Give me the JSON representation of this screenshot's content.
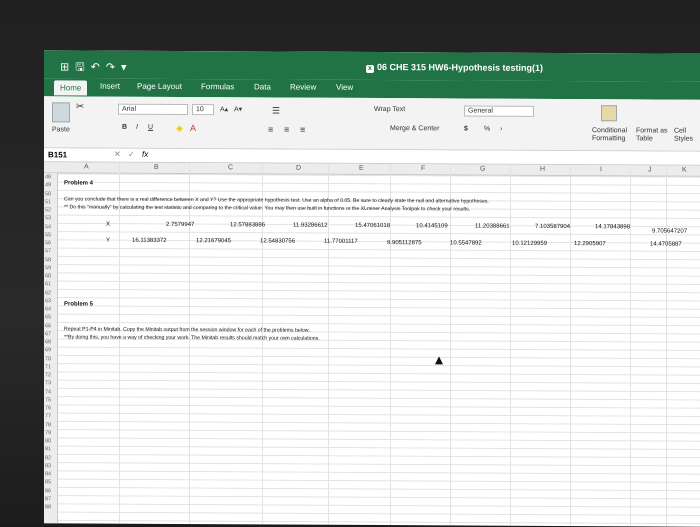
{
  "window": {
    "title": "06 CHE 315 HW6-Hypothesis testing(1)",
    "quick_access": [
      "⊞",
      "🖫",
      "↶",
      "↷",
      "▾"
    ]
  },
  "tabs": [
    "Home",
    "Insert",
    "Page Layout",
    "Formulas",
    "Data",
    "Review",
    "View"
  ],
  "ribbon": {
    "paste_label": "Paste",
    "font_name": "Arial",
    "font_size": "10",
    "font_grow": "A▴",
    "font_shrink": "A▾",
    "bold": "B",
    "italic": "I",
    "underline": "U",
    "wrap_text": "Wrap Text",
    "merge_center": "Merge & Center",
    "number_format": "General",
    "currency": "$",
    "percent": "%",
    "comma": "›",
    "conditional_formatting": "Conditional Formatting",
    "format_as_table": "Format as Table",
    "cell_styles": "Cell Styles"
  },
  "formula_bar": {
    "name_box": "B151",
    "fx": "fx",
    "formula": ""
  },
  "columns": [
    "A",
    "B",
    "C",
    "D",
    "E",
    "F",
    "G",
    "H",
    "I",
    "J",
    "K"
  ],
  "row_numbers": [
    "48",
    "49",
    "50",
    "51",
    "52",
    "53",
    "54",
    "55",
    "56",
    "57",
    "58",
    "59",
    "60",
    "61",
    "62",
    "63",
    "64",
    "65",
    "66",
    "67",
    "68",
    "69",
    "70",
    "71",
    "72",
    "73",
    "74",
    "75",
    "76",
    "77",
    "78",
    "79",
    "80",
    "81",
    "82",
    "83",
    "84",
    "85",
    "86",
    "87",
    "88"
  ],
  "sheet": {
    "problem4_title": "Problem 4",
    "problem4_line1": "Can you conclude that there is a real difference between X and Y? Use the appropriate hypothesis test. Use an alpha of 0.05. Be sure to clearly state the null and alternative hypotheses.",
    "problem4_line2": "** Do this \"manually\" by calculating the test statistic and comparing to the critical value.  You may then use built in functions or the XLminer Analysis Toolpak to check your results.",
    "label_x": "X",
    "label_y": "Y",
    "x_values": [
      "2.7579947",
      "12.57883886",
      "11.93286612",
      "15.47061018",
      "10.4145109",
      "11.20388661",
      "7.103587904",
      "14.17843898",
      "9.705647207"
    ],
    "y_values": [
      "16.11383372",
      "12.21679045",
      "12.54830756",
      "11.77001117",
      "9.905112875",
      "10.5547892",
      "10.12129959",
      "12.2905907",
      "14.4705887"
    ],
    "problem5_title": "Problem 5",
    "problem5_line1": "Repeat P1-P4 in Minitab. Copy the Minitab output from the session window for each of the problems below.",
    "problem5_line2": "**By doing this, you have a way of checking your work.  The Minitab results should match your own calculations."
  },
  "colors": {
    "accent": "#217346"
  }
}
